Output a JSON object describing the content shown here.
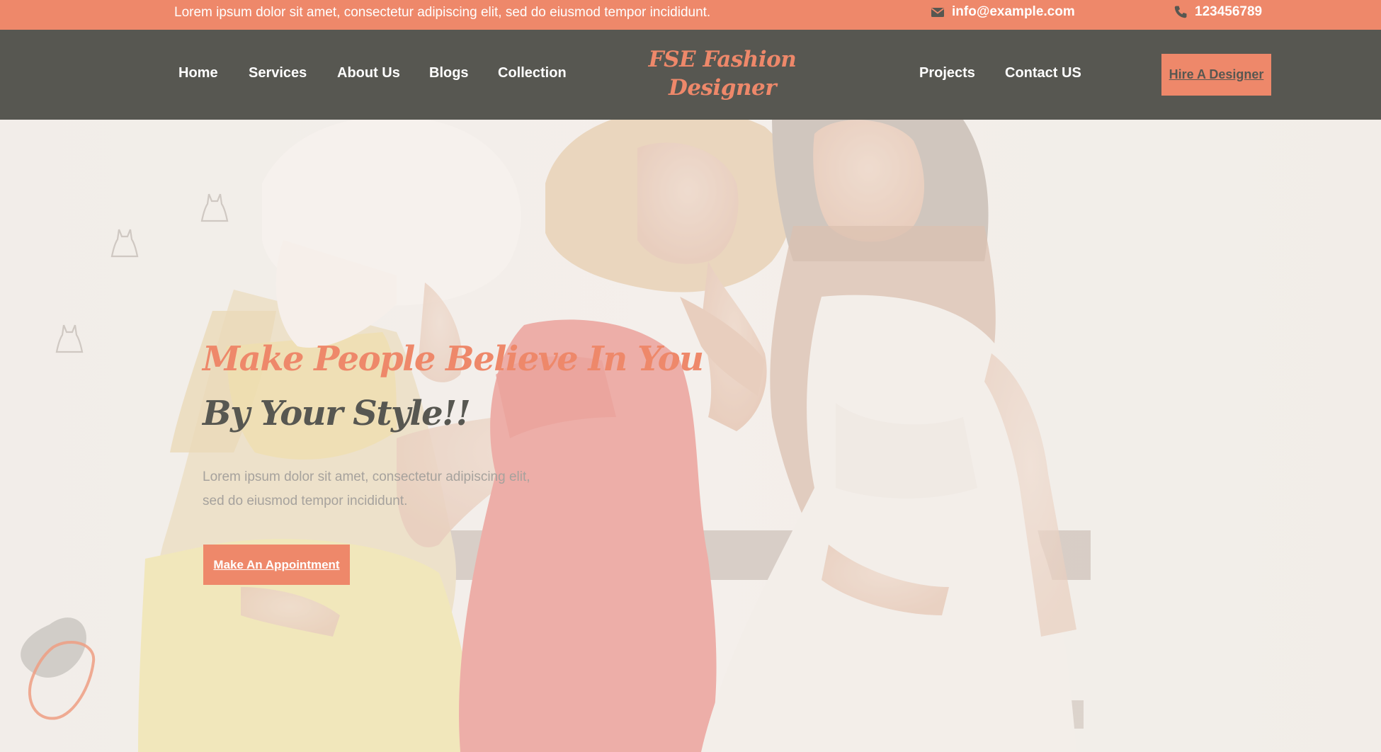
{
  "topbar": {
    "tagline": "Lorem ipsum dolor sit amet, consectetur adipiscing elit, sed do eiusmod tempor incididunt.",
    "email": "info@example.com",
    "phone": "123456789",
    "email_icon": "envelope-icon",
    "phone_icon": "phone-icon"
  },
  "nav": {
    "left_links": [
      "Home",
      "Services",
      "About Us",
      "Blogs",
      "Collection"
    ],
    "right_links": [
      "Projects",
      "Contact US"
    ],
    "logo_line1": "FSE Fashion",
    "logo_line2": "Designer",
    "hire_button": "Hire A Designer"
  },
  "hero": {
    "title_line1": "Make People Believe In You",
    "title_line2": "By Your Style!!",
    "description": "Lorem ipsum dolor sit amet, consectetur adipiscing elit, sed do eiusmod tempor incididunt.",
    "cta_button": "Make An Appointment",
    "decor_icon": "dress-icon"
  },
  "colors": {
    "accent": "#ee886a",
    "dark": "#575751",
    "background": "#f3efea"
  }
}
